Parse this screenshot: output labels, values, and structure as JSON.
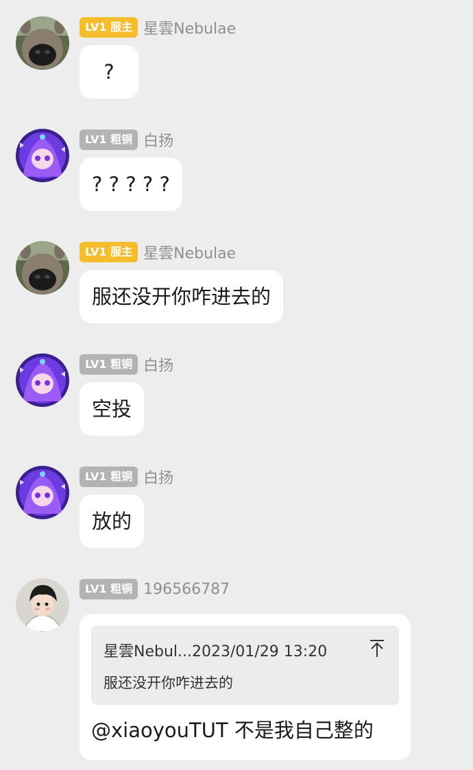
{
  "messages": [
    {
      "avatar": "dog-photo-avatar",
      "badge_level": "LV1",
      "badge_title": "服主",
      "badge_type": "owner",
      "nickname": "星雲Nebulae",
      "text": "?"
    },
    {
      "avatar": "anime-girl-avatar",
      "badge_level": "LV1",
      "badge_title": "粗铜",
      "badge_type": "member",
      "nickname": "白扬",
      "text": "? ? ? ? ?"
    },
    {
      "avatar": "dog-photo-avatar",
      "badge_level": "LV1",
      "badge_title": "服主",
      "badge_type": "owner",
      "nickname": "星雲Nebulae",
      "text": "服还没开你咋进去的"
    },
    {
      "avatar": "anime-girl-avatar",
      "badge_level": "LV1",
      "badge_title": "粗铜",
      "badge_type": "member",
      "nickname": "白扬",
      "text": "空投"
    },
    {
      "avatar": "anime-girl-avatar",
      "badge_level": "LV1",
      "badge_title": "粗铜",
      "badge_type": "member",
      "nickname": "白扬",
      "text": "放的"
    },
    {
      "avatar": "anime-boy-avatar",
      "badge_level": "LV1",
      "badge_title": "粗铜",
      "badge_type": "member",
      "nickname": "196566787",
      "quote": {
        "author": "星雲Nebul...",
        "time": "2023/01/29 13:20",
        "text": "服还没开你咋进去的",
        "icon": "jump-to-top-arrow-icon"
      },
      "text": "@xiaoyouTUT 不是我自己整的"
    }
  ],
  "colors": {
    "background": "#ededed",
    "bubble": "#ffffff",
    "owner_badge": "#f5bc2b",
    "member_badge": "#b3b3b3",
    "nickname": "#8f8f8f"
  }
}
